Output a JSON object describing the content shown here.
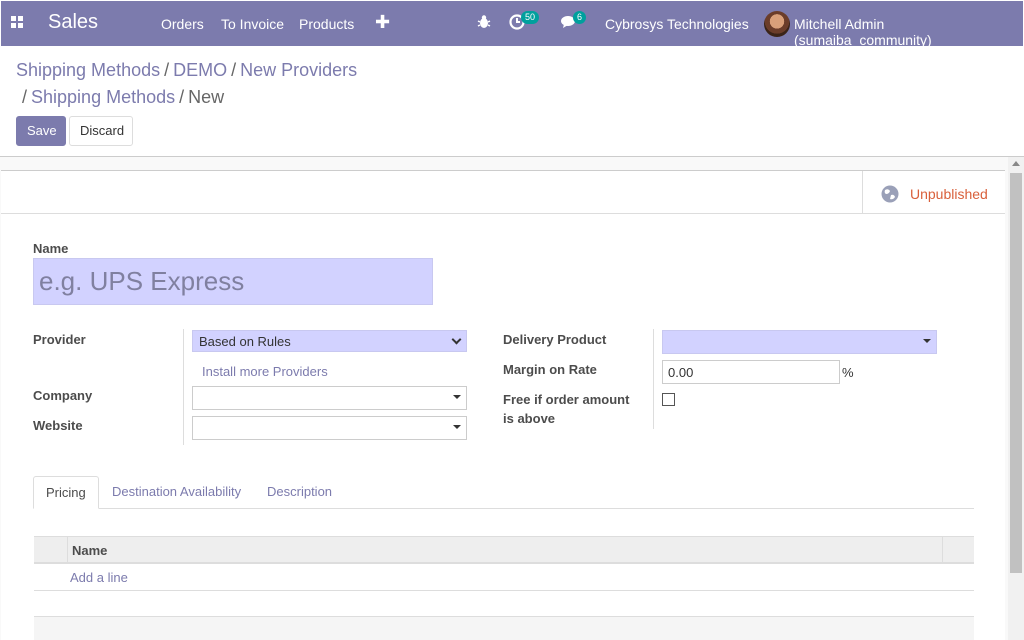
{
  "navbar": {
    "app_name": "Sales",
    "menu": [
      "Orders",
      "To Invoice",
      "Products"
    ],
    "activity_count": "50",
    "message_count": "6",
    "company": "Cybrosys Technologies",
    "user": "Mitchell Admin (sumaiba_community)",
    "accent_color": "#7c7bad"
  },
  "breadcrumb": {
    "line1": [
      "Shipping Methods",
      "DEMO",
      "New Providers"
    ],
    "line2": [
      "Shipping Methods"
    ],
    "current": "New",
    "separator": "/"
  },
  "buttons": {
    "save": "Save",
    "discard": "Discard"
  },
  "status": {
    "publish_label": "Unpublished"
  },
  "form": {
    "name_label": "Name",
    "name_placeholder": "e.g. UPS Express",
    "provider_label": "Provider",
    "provider_value": "Based on Rules",
    "install_link": "Install more Providers",
    "company_label": "Company",
    "company_value": "",
    "website_label": "Website",
    "website_value": "",
    "delivery_product_label": "Delivery Product",
    "delivery_product_value": "",
    "margin_label": "Margin on Rate",
    "margin_value": "0.00",
    "margin_unit": "%",
    "free_label_1": "Free if order amount",
    "free_label_2": "is above",
    "free_checked": false
  },
  "tabs": [
    {
      "label": "Pricing",
      "active": true
    },
    {
      "label": "Destination Availability",
      "active": false
    },
    {
      "label": "Description",
      "active": false
    }
  ],
  "table": {
    "column_name": "Name",
    "add_line": "Add a line"
  }
}
